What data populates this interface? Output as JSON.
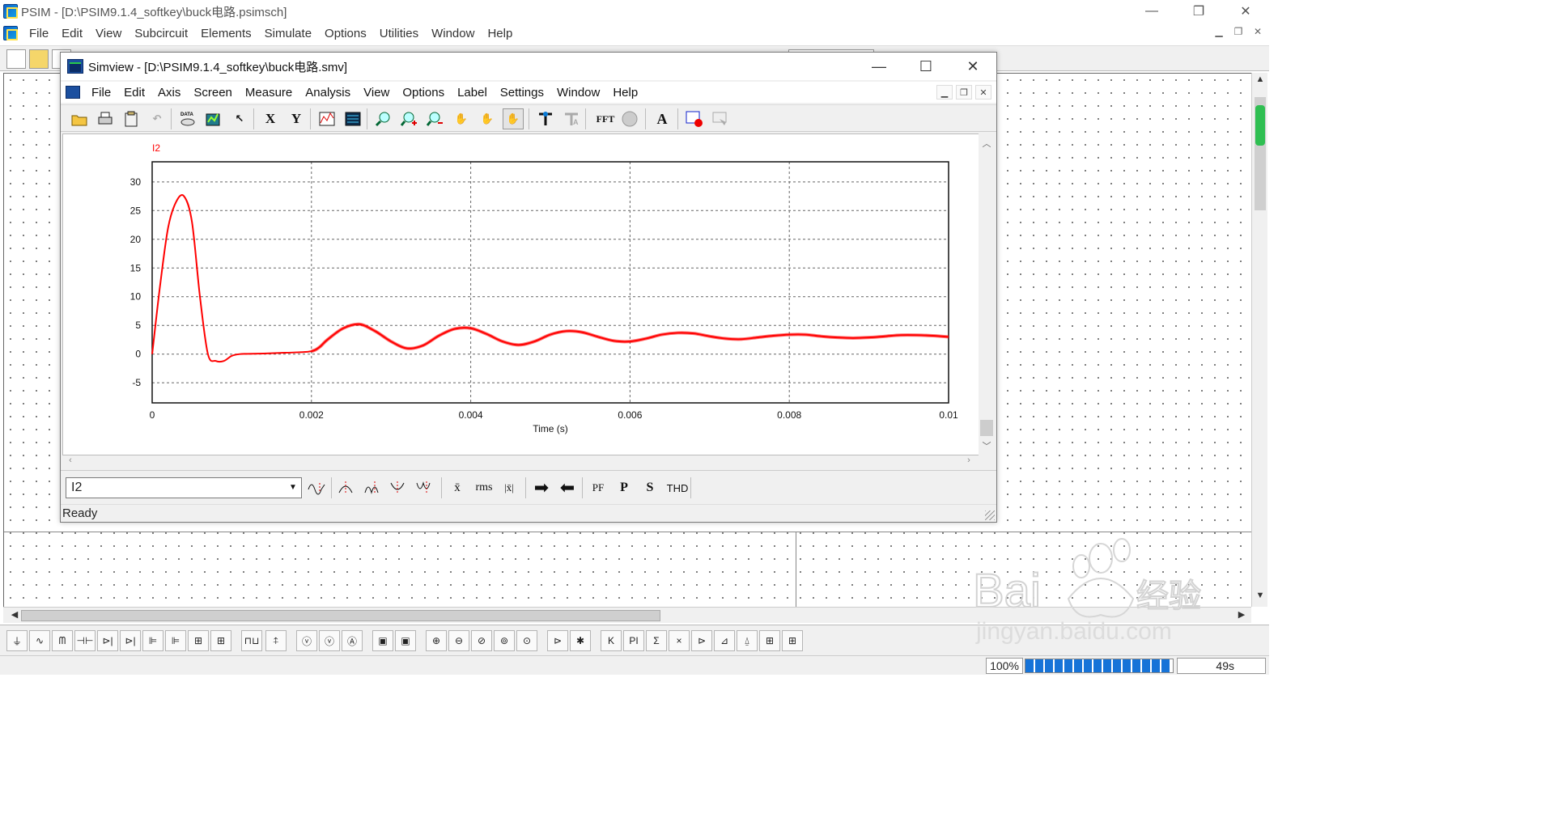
{
  "psim": {
    "title": "PSIM - [D:\\PSIM9.1.4_softkey\\buck电路.psimsch]",
    "menu": [
      "File",
      "Edit",
      "View",
      "Subcircuit",
      "Elements",
      "Simulate",
      "Options",
      "Utilities",
      "Window",
      "Help"
    ],
    "status": {
      "zoom": "100%",
      "progress_fraction": 0.98,
      "time": "49s"
    }
  },
  "simview": {
    "title": "Simview - [D:\\PSIM9.1.4_softkey\\buck电路.smv]",
    "menu": [
      "File",
      "Edit",
      "Axis",
      "Screen",
      "Measure",
      "Analysis",
      "View",
      "Options",
      "Label",
      "Settings",
      "Window",
      "Help"
    ],
    "toolbar": {
      "x_label": "X",
      "y_label": "Y",
      "fft_label": "FFT",
      "text_label": "A"
    },
    "bottom_toolbar": {
      "selected_variable": "I2",
      "rms_label": "rms",
      "pf_label": "PF",
      "p_label": "P",
      "s_label": "S",
      "thd_label": "THD"
    },
    "status_text": "Ready"
  },
  "chart_data": {
    "type": "line",
    "title": "",
    "xlabel": "Time (s)",
    "ylabel": "",
    "xlim": [
      0,
      0.01
    ],
    "ylim": [
      -8.5,
      33.5
    ],
    "x_ticks": [
      "0",
      "0.002",
      "0.004",
      "0.006",
      "0.008",
      "0.01"
    ],
    "y_ticks": [
      "30",
      "25",
      "20",
      "15",
      "10",
      "5",
      "0",
      "-5"
    ],
    "grid": true,
    "series": [
      {
        "name": "I2",
        "color": "#ff0000",
        "x": [
          0,
          0.0001,
          0.0002,
          0.0003,
          0.0004,
          0.0005,
          0.0006,
          0.0007,
          0.0008,
          0.0009,
          0.001,
          0.0011,
          0.0012,
          0.0014,
          0.0016,
          0.0018,
          0.002,
          0.0021,
          0.0022,
          0.0024,
          0.0026,
          0.0028,
          0.003,
          0.0032,
          0.0034,
          0.0036,
          0.0038,
          0.004,
          0.0042,
          0.0044,
          0.0046,
          0.0048,
          0.005,
          0.0052,
          0.0054,
          0.0056,
          0.0058,
          0.006,
          0.0062,
          0.0064,
          0.0066,
          0.0068,
          0.007,
          0.0072,
          0.0074,
          0.0076,
          0.0078,
          0.008,
          0.0082,
          0.0084,
          0.0086,
          0.0088,
          0.009,
          0.0092,
          0.0094,
          0.0096,
          0.0098,
          0.01
        ],
        "y": [
          0,
          12,
          22,
          26.5,
          27.5,
          23,
          10,
          0,
          -1.2,
          -1.2,
          -0.3,
          0,
          0.05,
          0.1,
          0.2,
          0.3,
          0.5,
          1.2,
          2.5,
          4.5,
          5.2,
          4.0,
          2.2,
          1.0,
          1.5,
          3.2,
          4.4,
          4.5,
          3.5,
          2.2,
          1.6,
          2.2,
          3.4,
          4.0,
          3.8,
          3.0,
          2.3,
          2.2,
          2.7,
          3.4,
          3.7,
          3.6,
          3.1,
          2.7,
          2.6,
          2.9,
          3.2,
          3.4,
          3.4,
          3.1,
          2.9,
          2.8,
          2.9,
          3.1,
          3.3,
          3.3,
          3.2,
          3.0
        ]
      }
    ]
  },
  "icons": {
    "psim_app": "psim-logo-icon",
    "simview_app": "simview-logo-icon"
  }
}
